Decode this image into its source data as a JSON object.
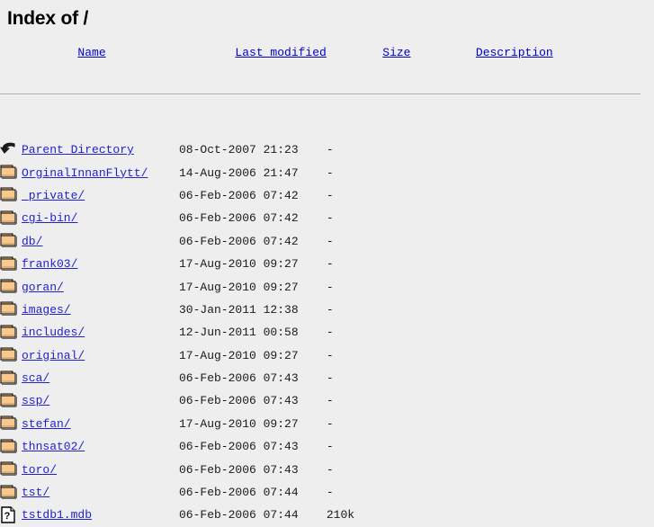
{
  "page": {
    "title": "Index of /",
    "background_color": "#eeeeee",
    "link_color": "#2222cc",
    "header_link_color": "#0000cc"
  },
  "table": {
    "columns": [
      {
        "label": "Name",
        "icon": "sort-name-icon"
      },
      {
        "label": "Last modified",
        "icon": "sort-date-icon"
      },
      {
        "label": "Size",
        "icon": "sort-size-icon"
      },
      {
        "label": "Description",
        "icon": "sort-desc-icon"
      }
    ],
    "rows": [
      {
        "icon": "back-arrow-icon",
        "name": "Parent Directory",
        "modified": "08-Oct-2007 21:23",
        "size": "-",
        "description": ""
      },
      {
        "icon": "folder-icon",
        "name": "OrginalInnanFlytt/",
        "modified": "14-Aug-2006 21:47",
        "size": "-",
        "description": ""
      },
      {
        "icon": "folder-icon",
        "name": "_private/",
        "modified": "06-Feb-2006 07:42",
        "size": "-",
        "description": ""
      },
      {
        "icon": "folder-icon",
        "name": "cgi-bin/",
        "modified": "06-Feb-2006 07:42",
        "size": "-",
        "description": ""
      },
      {
        "icon": "folder-icon",
        "name": "db/",
        "modified": "06-Feb-2006 07:42",
        "size": "-",
        "description": ""
      },
      {
        "icon": "folder-icon",
        "name": "frank03/",
        "modified": "17-Aug-2010 09:27",
        "size": "-",
        "description": ""
      },
      {
        "icon": "folder-icon",
        "name": "goran/",
        "modified": "17-Aug-2010 09:27",
        "size": "-",
        "description": ""
      },
      {
        "icon": "folder-icon",
        "name": "images/",
        "modified": "30-Jan-2011 12:38",
        "size": "-",
        "description": ""
      },
      {
        "icon": "folder-icon",
        "name": "includes/",
        "modified": "12-Jun-2011 00:58",
        "size": "-",
        "description": ""
      },
      {
        "icon": "folder-icon",
        "name": "original/",
        "modified": "17-Aug-2010 09:27",
        "size": "-",
        "description": ""
      },
      {
        "icon": "folder-icon",
        "name": "sca/",
        "modified": "06-Feb-2006 07:43",
        "size": "-",
        "description": ""
      },
      {
        "icon": "folder-icon",
        "name": "ssp/",
        "modified": "06-Feb-2006 07:43",
        "size": "-",
        "description": ""
      },
      {
        "icon": "folder-icon",
        "name": "stefan/",
        "modified": "17-Aug-2010 09:27",
        "size": "-",
        "description": ""
      },
      {
        "icon": "folder-icon",
        "name": "thnsat02/",
        "modified": "06-Feb-2006 07:43",
        "size": "-",
        "description": ""
      },
      {
        "icon": "folder-icon",
        "name": "toro/",
        "modified": "06-Feb-2006 07:43",
        "size": "-",
        "description": ""
      },
      {
        "icon": "folder-icon",
        "name": "tst/",
        "modified": "06-Feb-2006 07:44",
        "size": "-",
        "description": ""
      },
      {
        "icon": "unknown-file-icon",
        "name": "tstdb1.mdb",
        "modified": "06-Feb-2006 07:44",
        "size": "210k",
        "description": ""
      }
    ]
  }
}
